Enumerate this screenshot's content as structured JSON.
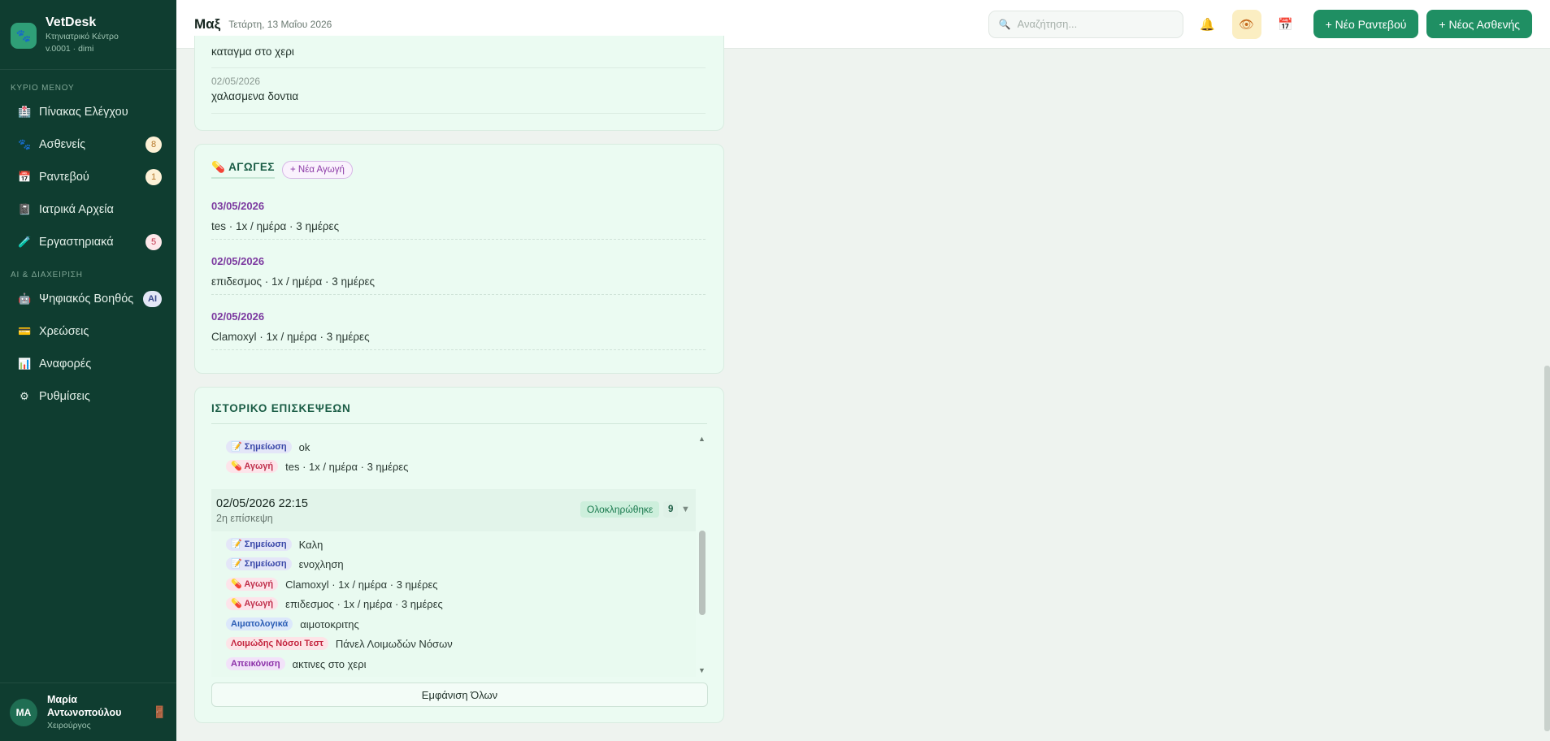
{
  "brand": {
    "name": "VetDesk",
    "subtitle": "Κτηνιατρικό Κέντρο",
    "meta": "v.0001 · dimi"
  },
  "sidebar": {
    "section_main": "ΚΥΡΙΟ ΜΕΝΟΥ",
    "section_ai": "AI & ΔΙΑΧΕΙΡΙΣΗ",
    "items": [
      {
        "label": "Πίνακας Ελέγχου",
        "icon": "clinic-icon"
      },
      {
        "label": "Ασθενείς",
        "icon": "paw-icon",
        "badge": "8"
      },
      {
        "label": "Ραντεβού",
        "icon": "calendar-icon",
        "badge": "1"
      },
      {
        "label": "Ιατρικά Αρχεία",
        "icon": "notebook-icon"
      },
      {
        "label": "Εργαστηριακά",
        "icon": "test-tube-icon",
        "badge": "5"
      },
      {
        "label": "Ψηφιακός Βοηθός",
        "icon": "robot-icon",
        "badge": "AI"
      },
      {
        "label": "Χρεώσεις",
        "icon": "card-icon"
      },
      {
        "label": "Αναφορές",
        "icon": "chart-icon"
      },
      {
        "label": "Ρυθμίσεις",
        "icon": "gear-icon"
      }
    ],
    "user": {
      "initials": "MA",
      "name_line1": "Μαρία",
      "name_line2": "Αντωνοπούλου",
      "role": "Χειρούργος"
    }
  },
  "topbar": {
    "title": "Μαξ",
    "date": "Τετάρτη, 13 Μαΐου 2026",
    "search_placeholder": "Αναζήτηση...",
    "new_appointment": "+ Νέο Ραντεβού",
    "new_patient": "+ Νέος Ασθενής"
  },
  "notes_card": {
    "entries": [
      {
        "text": "καταγμα στο χερι"
      },
      {
        "date": "02/05/2026",
        "text": "χαλασμενα δοντια"
      }
    ]
  },
  "treatments": {
    "title": "ΑΓΩΓΕΣ",
    "title_icon": "pill-icon",
    "new_button": "+ Νέα Αγωγή",
    "items": [
      {
        "date": "03/05/2026",
        "text": "tes · 1x / ημέρα · 3 ημέρες"
      },
      {
        "date": "02/05/2026",
        "text": "επιδεσμος · 1x / ημέρα · 3 ημέρες"
      },
      {
        "date": "02/05/2026",
        "text": "Clamoxyl · 1x / ημέρα · 3 ημέρες"
      }
    ]
  },
  "history": {
    "title": "ΙΣΤΟΡΙΚΟ ΕΠΙΣΚΕΨΕΩΝ",
    "prev_rows": [
      {
        "tag": "Σημείωση",
        "kind": "note",
        "text": "ok"
      },
      {
        "tag": "Αγωγή",
        "kind": "treat",
        "text": "tes · 1x / ημέρα · 3 ημέρες"
      }
    ],
    "visit": {
      "datetime": "02/05/2026 22:15",
      "subtitle": "2η επίσκεψη",
      "status": "Ολοκληρώθηκε",
      "count": "9"
    },
    "rows": [
      {
        "tag": "Σημείωση",
        "kind": "note",
        "text": "Καλη"
      },
      {
        "tag": "Σημείωση",
        "kind": "note",
        "text": "ενοχληση"
      },
      {
        "tag": "Αγωγή",
        "kind": "treat",
        "text": "Clamoxyl · 1x / ημέρα · 3 ημέρες"
      },
      {
        "tag": "Αγωγή",
        "kind": "treat",
        "text": "επιδεσμος · 1x / ημέρα · 3 ημέρες"
      },
      {
        "tag": "Αιματολογικά",
        "kind": "blood",
        "text": "αιμοτοκριτης"
      },
      {
        "tag": "Λοιμώδης Νόσοι Τεστ",
        "kind": "infect",
        "text": "Πάνελ Λοιμωδών Νόσων"
      },
      {
        "tag": "Απεικόνιση",
        "kind": "img",
        "text": "ακτινες στο χερι"
      }
    ],
    "show_all": "Εμφάνιση Όλων"
  }
}
